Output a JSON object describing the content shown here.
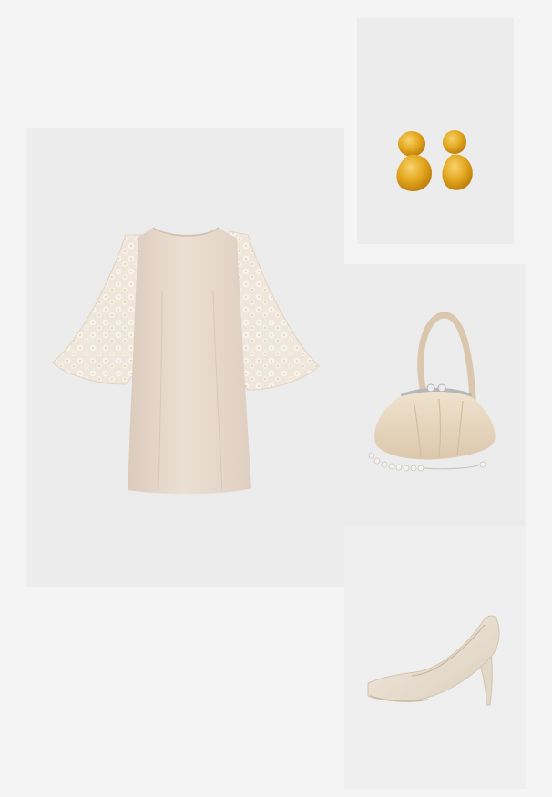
{
  "collage": {
    "background_color": "#f4f4f4",
    "tile_color": "#ececec",
    "items": [
      {
        "id": "dress",
        "icon": "dress-icon",
        "color": "#e9d9cc"
      },
      {
        "id": "earrings",
        "icon": "earrings-icon",
        "color": "#e2a21c"
      },
      {
        "id": "handbag",
        "icon": "handbag-icon",
        "color": "#ead9c0"
      },
      {
        "id": "pump-shoe",
        "icon": "shoe-icon",
        "color": "#eae1d3"
      }
    ]
  }
}
